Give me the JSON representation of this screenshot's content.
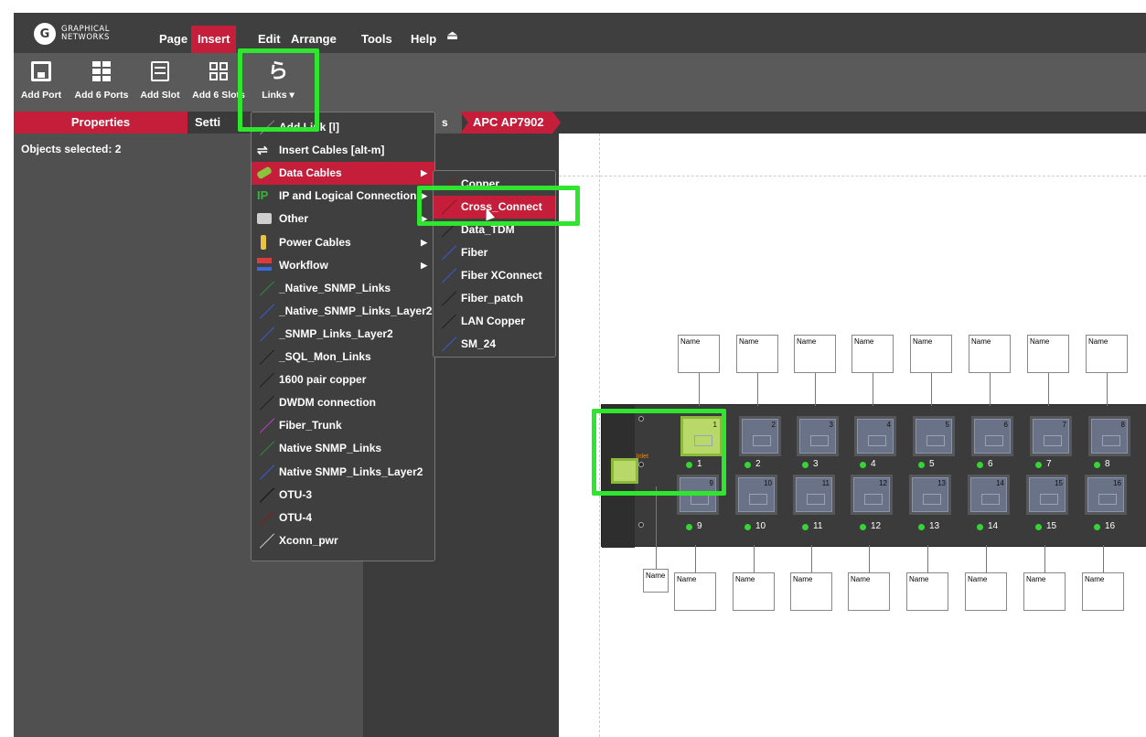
{
  "logo": {
    "mark": "G",
    "line1": "GRAPHICAL",
    "line2": "NETWORKS"
  },
  "menubar": {
    "items": [
      "Page",
      "Insert",
      "Edit",
      "Arrange",
      "Tools",
      "Help"
    ],
    "active": "Insert",
    "extra_icon": "⏏"
  },
  "toolbar": {
    "add_port": "Add Port",
    "add_6_ports": "Add 6 Ports",
    "add_slot": "Add Slot",
    "add_6_slots": "Add 6 Slots",
    "links": "Links ▾"
  },
  "tabs": {
    "properties": "Properties",
    "settings": "Setti"
  },
  "breadcrumb": {
    "partial": "s",
    "active": "APC AP7902"
  },
  "props": {
    "selected": "Objects selected: 2"
  },
  "links_menu": {
    "items": [
      {
        "label": "Add Link [l]",
        "icon": "diagonal-line-icon"
      },
      {
        "label": "Insert Cables [alt-m]",
        "icon": "cables-icon"
      },
      {
        "label": "Data Cables",
        "icon": "data-cable-icon",
        "submenu": true,
        "highlight": true
      },
      {
        "label": "IP and Logical Connections",
        "icon": "ip-icon",
        "submenu": true
      },
      {
        "label": "Other",
        "icon": "printer-icon",
        "submenu": true
      },
      {
        "label": "Power Cables",
        "icon": "plug-icon",
        "submenu": true
      },
      {
        "label": "Workflow",
        "icon": "workflow-icon",
        "submenu": true
      },
      {
        "label": "_Native_SNMP_Links",
        "color": "#2e8b3a"
      },
      {
        "label": "_Native_SNMP_Links_Layer2",
        "color": "#3a5ad8"
      },
      {
        "label": "_SNMP_Links_Layer2",
        "color": "#3a5ad8"
      },
      {
        "label": "_SQL_Mon_Links",
        "color": "#222222"
      },
      {
        "label": "1600 pair copper",
        "color": "#222222"
      },
      {
        "label": "DWDM connection",
        "color": "#222222"
      },
      {
        "label": "Fiber_Trunk",
        "color": "#c03cc0"
      },
      {
        "label": "Native SNMP_Links",
        "color": "#2e8b3a"
      },
      {
        "label": "Native SNMP_Links_Layer2",
        "color": "#3a5ad8"
      },
      {
        "label": "OTU-3",
        "color": "#111111"
      },
      {
        "label": "OTU-4",
        "color": "#8b1a1a"
      },
      {
        "label": "Xconn_pwr",
        "color": "#cccccc"
      }
    ]
  },
  "data_cables_submenu": {
    "items": [
      {
        "label": "Copper",
        "color": "#8b1a1a"
      },
      {
        "label": "Cross_Connect",
        "color": "#8b1a1a",
        "highlight": true
      },
      {
        "label": "Data_TDM",
        "color": "#222222"
      },
      {
        "label": "Fiber",
        "color": "#3a5ad8"
      },
      {
        "label": "Fiber XConnect",
        "color": "#3a5ad8"
      },
      {
        "label": "Fiber_patch",
        "color": "#222222"
      },
      {
        "label": "LAN Copper",
        "color": "#222222"
      },
      {
        "label": "SM_24",
        "color": "#3a5ad8"
      }
    ]
  },
  "device": {
    "name_label": "Name",
    "top_ports": [
      "1",
      "2",
      "3",
      "4",
      "5",
      "6",
      "7",
      "8"
    ],
    "bottom_ports": [
      "9",
      "10",
      "11",
      "12",
      "13",
      "14",
      "15",
      "16"
    ],
    "inlet_label": "Inlet"
  },
  "colors": {
    "accent": "#c41e3a",
    "highlight": "#2ee62e",
    "menubar": "#3f3f3f",
    "toolbar": "#5a5a5a"
  }
}
